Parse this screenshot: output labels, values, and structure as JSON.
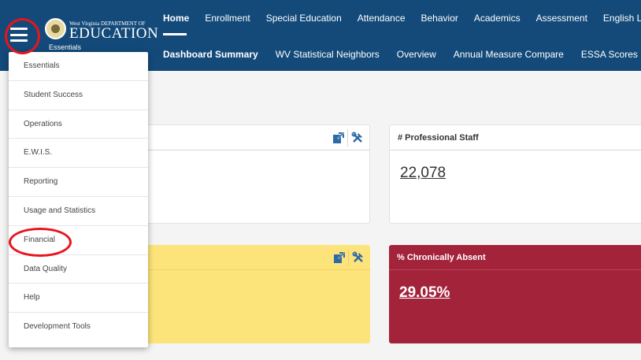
{
  "brand": {
    "tagline": "West Virginia DEPARTMENT OF",
    "title": "EDUCATION",
    "subtitle": "Essentials"
  },
  "nav": {
    "main": [
      "Home",
      "Enrollment",
      "Special Education",
      "Attendance",
      "Behavior",
      "Academics",
      "Assessment",
      "English Learner"
    ],
    "sub": [
      "Dashboard Summary",
      "WV Statistical Neighbors",
      "Overview",
      "Annual Measure Compare",
      "ESSA Scores"
    ]
  },
  "menu": {
    "items": [
      "Essentials",
      "Student Success",
      "Operations",
      "E.W.I.S.",
      "Reporting",
      "Usage and Statistics",
      "Financial",
      "Data Quality",
      "Help",
      "Development Tools"
    ]
  },
  "cards": {
    "card1": {
      "title": ""
    },
    "professional_staff": {
      "title": "# Professional Staff",
      "value": "22,078"
    },
    "card3": {
      "title": ""
    },
    "chronically_absent": {
      "title": "% Chronically Absent",
      "value": "29.05%"
    }
  },
  "colors": {
    "header": "#134a7a",
    "yellow_card": "#fde47a",
    "red_card": "#a3233b",
    "annotation": "#e8141c"
  },
  "icons": [
    "hamburger-menu-icon",
    "seal-icon",
    "external-link-icon",
    "tools-icon"
  ]
}
